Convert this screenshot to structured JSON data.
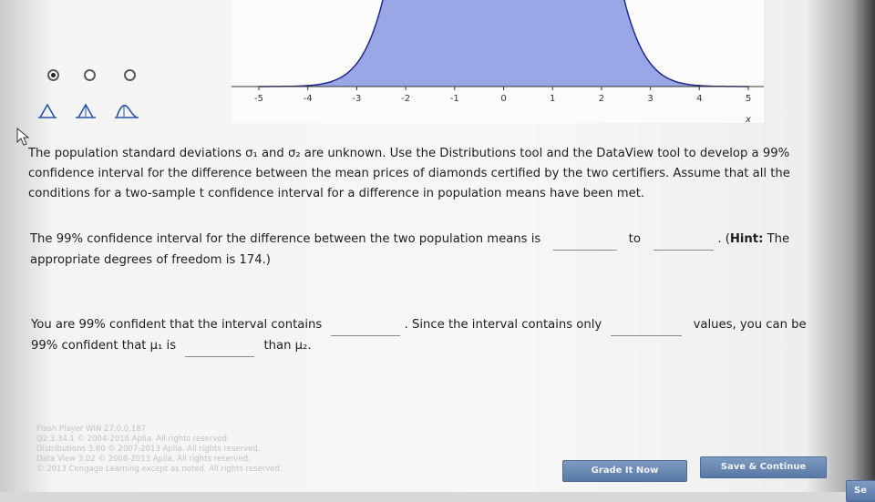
{
  "plot": {
    "x_ticks": [
      "-5",
      "-4",
      "-3",
      "-2",
      "-1",
      "0",
      "1",
      "2",
      "3",
      "4",
      "5"
    ],
    "x_label": "x",
    "fill_color": "#9aa7e6",
    "curve_color": "#1f2a8a"
  },
  "distribution_selector": {
    "options": [
      "distribution-1",
      "distribution-2",
      "distribution-3"
    ],
    "selected_index": 0
  },
  "question": {
    "line1": "The population standard deviations σ₁ and σ₂ are unknown.  Use the Distributions tool and the DataView tool to develop a 99%",
    "line2": "confidence interval for the difference between the mean prices of diamonds certified by the two certifiers. Assume that all the",
    "line3": "conditions for a two-sample t confidence interval for a difference in population means have been met."
  },
  "ci_sentence": {
    "text1": "The 99% confidence interval for the difference between the two population means is",
    "to": "to",
    "hint_label": "Hint:",
    "hint_text": "The",
    "line2": "appropriate degrees of freedom is 174.)"
  },
  "conclusion": {
    "text1": "You are 99% confident that the interval contains",
    "text2": ". Since the interval contains only",
    "text3": "values, you can be",
    "text4": "99% confident that μ₁ is",
    "text5": "than μ₂."
  },
  "footer": {
    "lines": [
      "Flash Player WIN 27,0,0,187",
      "Q2 3.34.1 © 2004-2016 Aplia. All rights reserved.",
      "Distributions 3.60 © 2007-2013 Aplia. All rights reserved.",
      "Data View 3.02 © 2008-2013 Aplia. All rights reserved.",
      "© 2013 Cengage Learning except as noted. All rights reserved."
    ]
  },
  "buttons": {
    "grade": "Grade It Now",
    "save": "Save & Continue",
    "partial": "Se"
  }
}
